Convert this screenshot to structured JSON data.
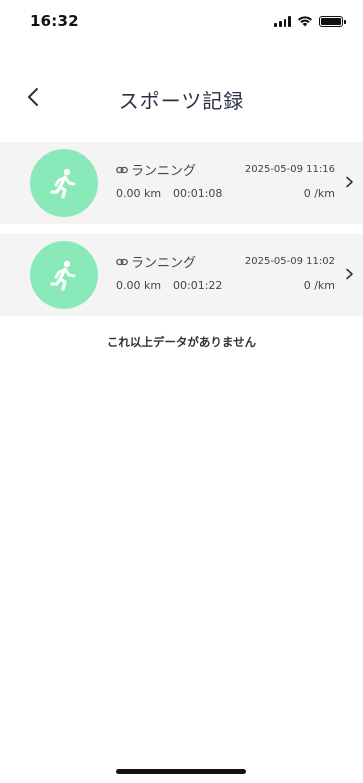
{
  "status_bar": {
    "time": "16:32",
    "icons": [
      "signal-icon",
      "wifi-icon",
      "battery-icon"
    ]
  },
  "nav": {
    "back_icon": "chevron-left-icon",
    "title": "スポーツ記録"
  },
  "records": [
    {
      "sport": "ランニング",
      "date": "2025-05-09 11:16",
      "distance": "0.00 km",
      "duration": "00:01:08",
      "pace": "0 /km"
    },
    {
      "sport": "ランニング",
      "date": "2025-05-09 11:02",
      "distance": "0.00 km",
      "duration": "00:01:22",
      "pace": "0 /km"
    }
  ],
  "footer_text": "これ以上データがありません",
  "colors": {
    "accent_green": "#8ae9b8",
    "card_bg": "#f3f4f3",
    "title": "#2a2f45"
  }
}
